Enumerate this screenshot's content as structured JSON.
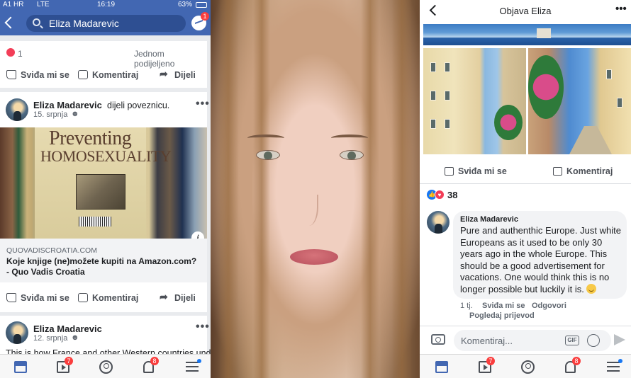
{
  "left": {
    "status": {
      "carrier": "A1 HR",
      "network": "LTE",
      "time": "16:19",
      "battery": "63%"
    },
    "search": {
      "query": "Eliza Madarevic"
    },
    "messenger_badge": "1",
    "post1_footer": {
      "reaction_count": "1",
      "shares": "Jednom podijeljeno"
    },
    "actions": {
      "like": "Sviđa mi se",
      "comment": "Komentiraj",
      "share": "Dijeli"
    },
    "post2": {
      "author": "Eliza Madarevic",
      "verb": "dijeli poveznicu.",
      "date": "15. srpnja",
      "book_title_1": "Preventing",
      "book_title_2": "Homosexuality",
      "link_domain": "QUOVADISCROATIA.COM",
      "link_title": "Koje knjige (ne)možete kupiti na Amazon.com? - Quo Vadis Croatia"
    },
    "post3": {
      "author": "Eliza Madarevic",
      "date": "12. srpnja",
      "text": "This is how France and other Western countries under"
    },
    "tabbar": {
      "video_badge": "7",
      "notif_badge": "8"
    }
  },
  "right": {
    "title": "Objava Eliza",
    "actions": {
      "like": "Sviđa mi se",
      "comment": "Komentiraj"
    },
    "reaction_count": "38",
    "comment": {
      "author": "Eliza Madarevic",
      "text": "Pure and authenthic Europe. Just white Europeans as it used to be only 30 years ago in the whole Europe. This should be a good advertisement for vacations. One would think this is no longer possible but luckily it is.",
      "age": "1 tj.",
      "like": "Sviđa mi se",
      "reply": "Odgovori",
      "translate": "Pogledaj prijevod"
    },
    "composer_placeholder": "Komentiraj...",
    "gif_label": "GIF",
    "tabbar": {
      "video_badge": "7",
      "notif_badge": "8"
    }
  },
  "colors": {
    "facebook_blue": "#4267b2",
    "badge_red": "#fa3e3e",
    "link_blue": "#1877f2"
  }
}
